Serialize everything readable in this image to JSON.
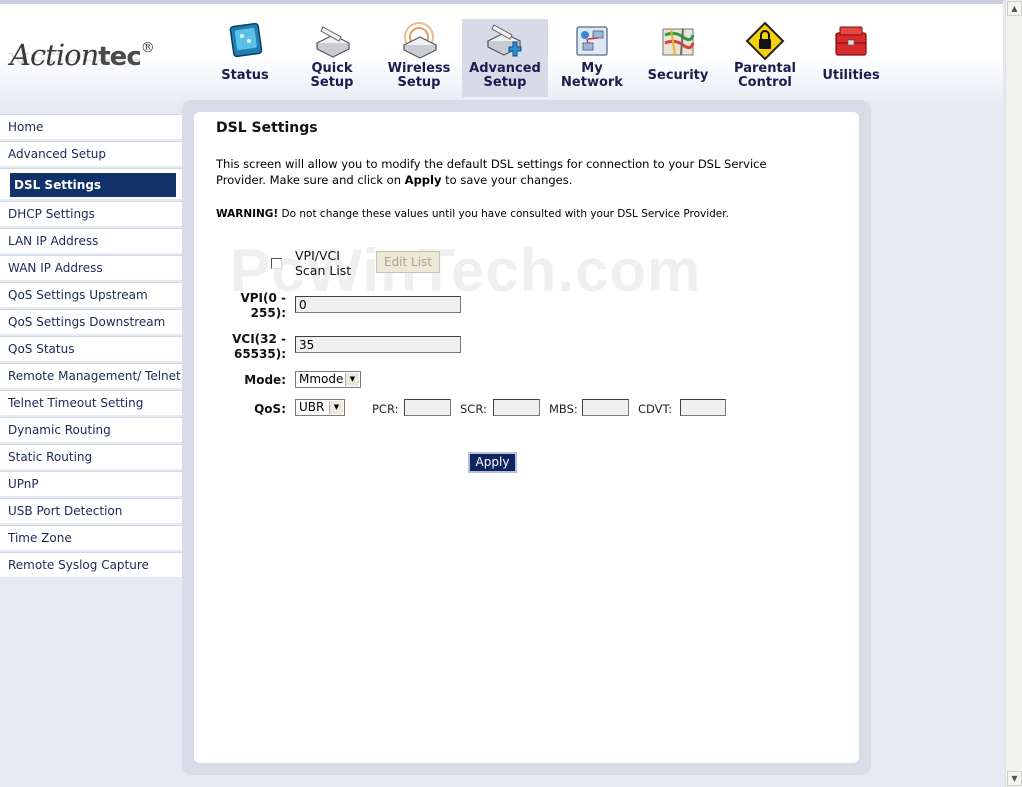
{
  "brand": {
    "logo_main": "Action",
    "logo_bold": "tec",
    "logo_reg": "®"
  },
  "nav": [
    {
      "label": "Status",
      "icon": "status-icon"
    },
    {
      "label": "Quick Setup",
      "icon": "quick-setup-icon"
    },
    {
      "label": "Wireless Setup",
      "icon": "wireless-setup-icon"
    },
    {
      "label": "Advanced Setup",
      "icon": "advanced-setup-icon",
      "active": true
    },
    {
      "label": "My Network",
      "icon": "my-network-icon"
    },
    {
      "label": "Security",
      "icon": "security-icon"
    },
    {
      "label": "Parental Control",
      "icon": "parental-control-icon"
    },
    {
      "label": "Utilities",
      "icon": "utilities-icon"
    }
  ],
  "sidebar": {
    "items": [
      "Home",
      "Advanced Setup",
      "DSL Settings",
      "DHCP Settings",
      "LAN IP Address",
      "WAN IP Address",
      "QoS Settings Upstream",
      "QoS Settings Downstream",
      "QoS Status",
      "Remote Management/ Telnet",
      "Telnet Timeout Setting",
      "Dynamic Routing",
      "Static Routing",
      "UPnP",
      "USB Port Detection",
      "Time Zone",
      "Remote Syslog Capture"
    ],
    "active_index": 2
  },
  "main": {
    "title": "DSL Settings",
    "intro_line1": "This screen will allow you to modify the default DSL settings for connection to your DSL Service",
    "intro_line2_pre": "Provider. Make sure and click on ",
    "intro_line2_bold": "Apply",
    "intro_line2_post": " to save your changes.",
    "warning_bold": "WARNING!",
    "warning_text": " Do not change these values until you have consulted with your DSL Service Provider.",
    "watermark": "PcWinTech.com",
    "scan_list_label_1": "VPI/VCI",
    "scan_list_label_2": "Scan List",
    "scan_list_checked": false,
    "edit_list_label": "Edit List",
    "vpi_label_1": "VPI(0 -",
    "vpi_label_2": "255):",
    "vpi_value": "0",
    "vci_label_1": "VCI(32 -",
    "vci_label_2": "65535):",
    "vci_value": "35",
    "mode_label": "Mode:",
    "mode_value": "Mmode",
    "qos_label": "QoS:",
    "qos_value": "UBR",
    "pcr_label": "PCR:",
    "pcr_value": "",
    "scr_label": "SCR:",
    "scr_value": "",
    "mbs_label": "MBS:",
    "mbs_value": "",
    "cdvt_label": "CDVT:",
    "cdvt_value": "",
    "apply_label": "Apply"
  },
  "colors": {
    "nav_text": "#1a1d4d",
    "sidebar_active_bg": "#11316a",
    "apply_bg": "#0f2463",
    "page_bg": "#e6e9f1"
  }
}
